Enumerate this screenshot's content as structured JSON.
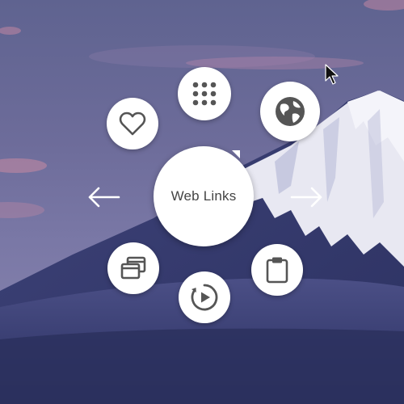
{
  "wheel": {
    "center_label": "Web Links",
    "items": [
      {
        "name": "apps",
        "icon": "app-grid-icon"
      },
      {
        "name": "browser",
        "icon": "globe-icon"
      },
      {
        "name": "favorites",
        "icon": "heart-icon"
      },
      {
        "name": "clipboard",
        "icon": "clipboard-icon"
      },
      {
        "name": "windows",
        "icon": "windows-stack-icon"
      },
      {
        "name": "media",
        "icon": "play-circle-icon"
      }
    ],
    "prev_icon": "arrow-left-icon",
    "next_icon": "arrow-right-icon"
  },
  "colors": {
    "button_bg": "#ffffff",
    "icon": "#555555",
    "arrow": "#ffffff"
  }
}
